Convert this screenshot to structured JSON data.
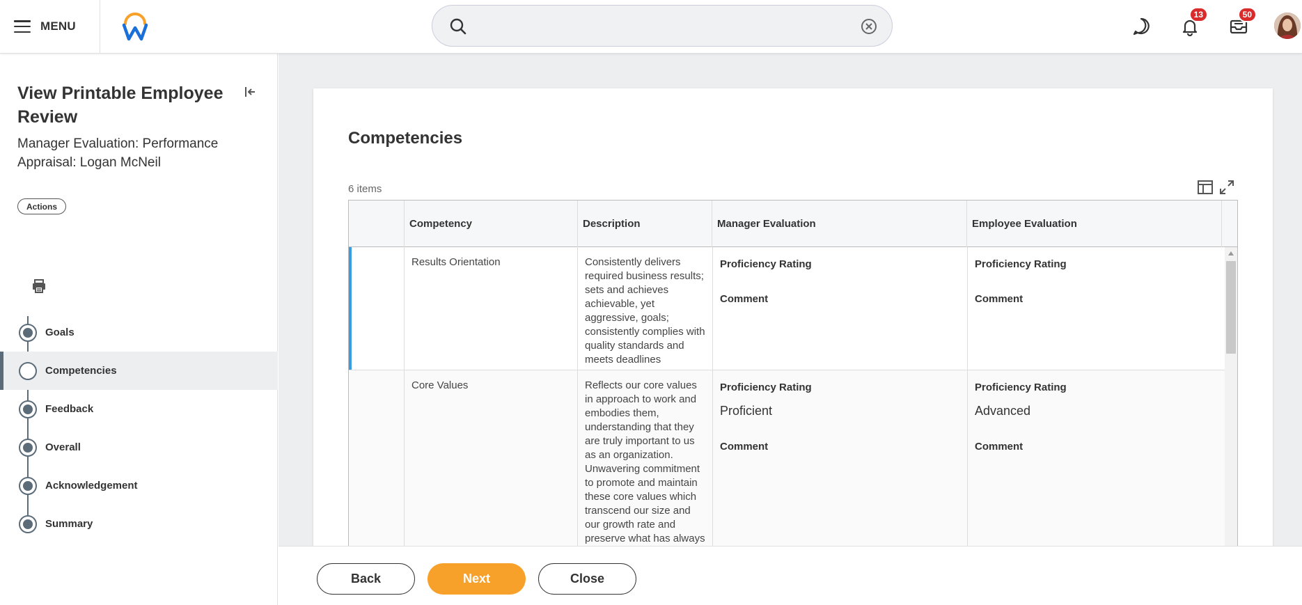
{
  "header": {
    "menu_label": "MENU",
    "search": {
      "value": "",
      "placeholder": ""
    },
    "notifications_count": "13",
    "inbox_count": "50"
  },
  "sidebar": {
    "title": "View Printable Employee Review",
    "subtitle": "Manager Evaluation: Performance Appraisal: Logan McNeil",
    "actions_label": "Actions",
    "steps": [
      {
        "label": "Goals"
      },
      {
        "label": "Competencies"
      },
      {
        "label": "Feedback"
      },
      {
        "label": "Overall"
      },
      {
        "label": "Acknowledgement"
      },
      {
        "label": "Summary"
      }
    ],
    "active_step": "Competencies"
  },
  "main": {
    "section_title": "Competencies",
    "item_count": "6 items",
    "columns": [
      "Competency",
      "Description",
      "Manager Evaluation",
      "Employee Evaluation"
    ],
    "rows": [
      {
        "competency": "Results Orientation",
        "description": "Consistently delivers required business results; sets and achieves achievable, yet aggressive, goals; consistently complies with quality standards and meets deadlines",
        "manager": {
          "rating_label": "Proficiency Rating",
          "rating_value": "",
          "comment_label": "Comment"
        },
        "employee": {
          "rating_label": "Proficiency Rating",
          "rating_value": "",
          "comment_label": "Comment"
        }
      },
      {
        "competency": "Core Values",
        "description": "Reflects our core values in approach to work and embodies them, understanding that they are truly important to us as an organization. Unwavering commitment to promote and maintain these core values which transcend our size and our growth rate and preserve what has always",
        "manager": {
          "rating_label": "Proficiency Rating",
          "rating_value": "Proficient",
          "comment_label": "Comment"
        },
        "employee": {
          "rating_label": "Proficiency Rating",
          "rating_value": "Advanced",
          "comment_label": "Comment"
        }
      }
    ]
  },
  "footer": {
    "back_label": "Back",
    "next_label": "Next",
    "close_label": "Close"
  },
  "colors": {
    "accent_orange": "#f8a12a",
    "badge_red": "#d92b2b",
    "selection_blue": "#3a9be0",
    "step_gray": "#5b6b78"
  }
}
